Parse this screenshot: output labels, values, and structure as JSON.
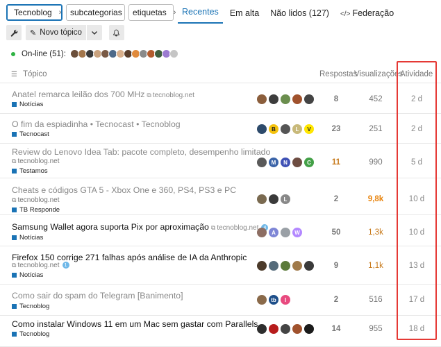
{
  "nav": {
    "chips": [
      "Tecnoblog",
      "subcategorias",
      "etiquetas"
    ],
    "tabs": [
      "Recentes",
      "Em alta",
      "Não lidos (127)",
      "Federação"
    ]
  },
  "toolbar": {
    "new_topic": "Novo tópico"
  },
  "online": {
    "label": "On-line (51):"
  },
  "header": {
    "topic": "Tópico",
    "replies": "Respostas",
    "views": "Visualizações",
    "activity": "Atividade"
  },
  "topics": [
    {
      "title": "Anatel remarca leilão dos 700 MHz",
      "domain": "tecnoblog.net",
      "domain_inline": true,
      "category": "Notícias",
      "replies": "8",
      "views": "452",
      "activity": "2 d",
      "unread": false
    },
    {
      "title": "O fim da espiadinha • Tecnocast • Tecnoblog",
      "domain": "",
      "domain_inline": true,
      "category": "Tecnocast",
      "replies": "23",
      "views": "251",
      "activity": "2 d",
      "unread": false
    },
    {
      "title": "Review do Lenovo Idea Tab: pacote completo, desempenho limitado",
      "domain": "tecnoblog.net",
      "domain_inline": false,
      "category": "Testamos",
      "replies": "11",
      "views": "990",
      "activity": "5 d",
      "unread": false
    },
    {
      "title": "Cheats e códigos GTA 5 - Xbox One e 360, PS4, PS3 e PC",
      "domain": "tecnoblog.net",
      "domain_inline": false,
      "category": "TB Responde",
      "replies": "2",
      "views": "9,8k",
      "activity": "10 d",
      "unread": false
    },
    {
      "title": "Samsung Wallet agora suporta Pix por aproximação",
      "domain": "tecnoblog.net",
      "domain_inline": true,
      "badge": "4",
      "category": "Notícias",
      "replies": "50",
      "views": "1,3k",
      "activity": "10 d",
      "unread": true
    },
    {
      "title": "Firefox 150 corrige 271 falhas após análise de IA da Anthropic",
      "domain": "tecnoblog.net",
      "domain_inline": false,
      "badge": "1",
      "category": "Notícias",
      "replies": "9",
      "views": "1,1k",
      "activity": "13 d",
      "unread": true
    },
    {
      "title": "Como sair do spam do Telegram [Banimento]",
      "domain": "",
      "domain_inline": true,
      "category": "Tecnoblog",
      "replies": "2",
      "views": "516",
      "activity": "17 d",
      "unread": false
    },
    {
      "title": "Como instalar Windows 11 em um Mac sem gastar com Parallels",
      "domain": "",
      "domain_inline": true,
      "category": "Tecnoblog",
      "replies": "14",
      "views": "955",
      "activity": "18 d",
      "unread": true
    }
  ],
  "colors": {
    "accent": "#1a73b5",
    "highlight_box": "#e53935",
    "views_hot": "#e8830c",
    "views_warm": "#c7791a",
    "reply_hot": "#c7791a"
  }
}
